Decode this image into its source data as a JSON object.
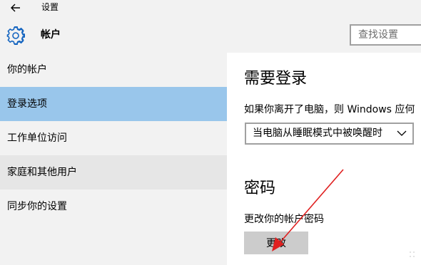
{
  "header": {
    "app_title": "设置",
    "section_title": "帐户",
    "back_icon": "back-arrow-icon",
    "settings_icon": "gear-icon",
    "search_placeholder": "查找设置"
  },
  "sidebar": {
    "items": [
      {
        "label": "你的帐户",
        "state": "normal"
      },
      {
        "label": "登录选项",
        "state": "selected"
      },
      {
        "label": "工作单位访问",
        "state": "normal"
      },
      {
        "label": "家庭和其他用户",
        "state": "hovered"
      },
      {
        "label": "同步你的设置",
        "state": "normal"
      }
    ]
  },
  "main": {
    "require_signin": {
      "heading": "需要登录",
      "description": "如果你离开了电脑，则 Windows 应何",
      "dropdown_value": "当电脑从睡眠模式中被唤醒时"
    },
    "password": {
      "heading": "密码",
      "description": "更改你的帐户密码",
      "button_label": "更改"
    }
  },
  "colors": {
    "chrome_bg": "#f2f2f2",
    "selected_bg": "#99c6eb",
    "hover_bg": "#e6e6e6",
    "button_bg": "#cccccc",
    "annotation_arrow": "#e02020"
  }
}
